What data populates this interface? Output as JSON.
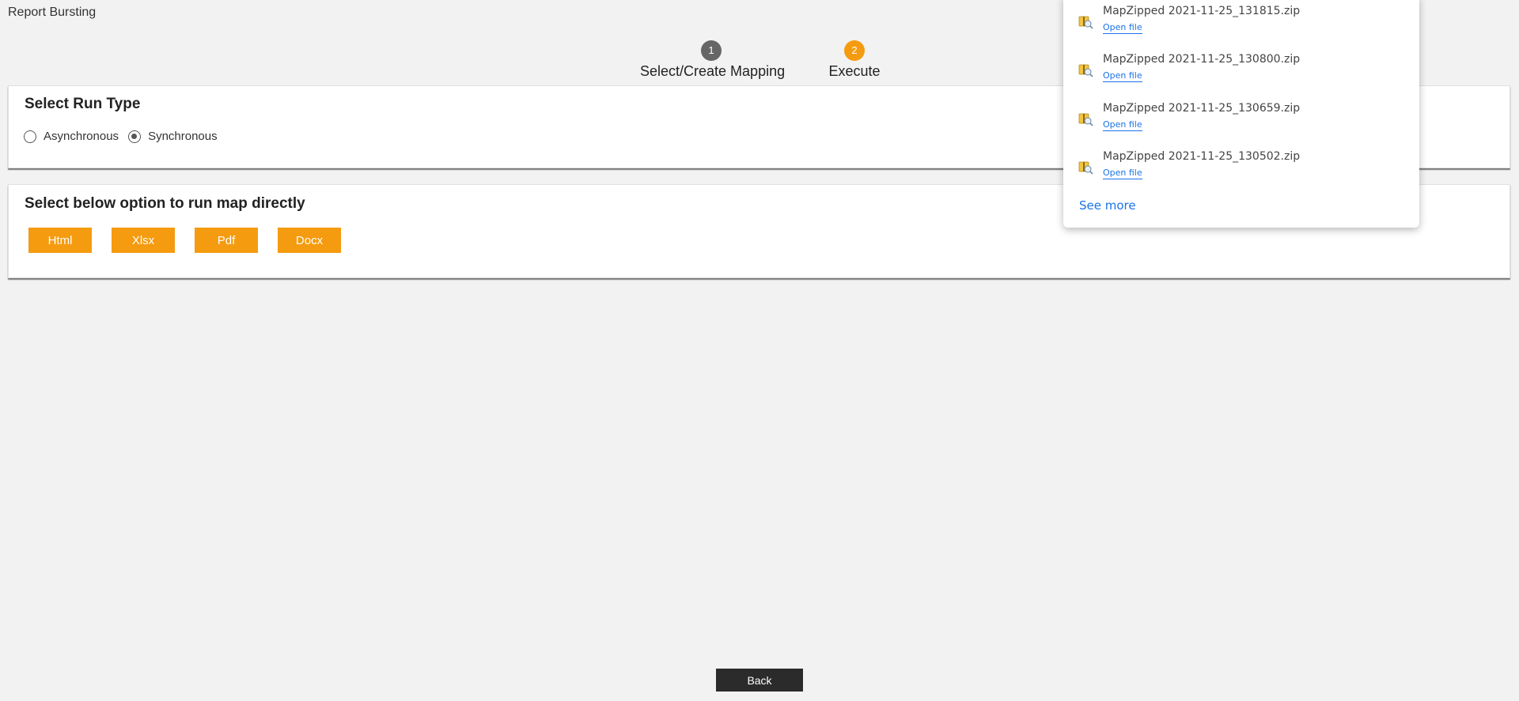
{
  "app": {
    "title": "Report Bursting"
  },
  "stepper": {
    "steps": [
      {
        "number": "1",
        "label": "Select/Create Mapping"
      },
      {
        "number": "2",
        "label": "Execute"
      }
    ]
  },
  "run_type": {
    "title": "Select Run Type",
    "options": [
      {
        "label": "Asynchronous",
        "selected": false
      },
      {
        "label": "Synchronous",
        "selected": true
      }
    ]
  },
  "run_map": {
    "title": "Select below option to run map directly",
    "buttons": [
      "Html",
      "Xlsx",
      "Pdf",
      "Docx"
    ]
  },
  "downloads": {
    "items": [
      {
        "name": "MapZipped 2021-11-25_131815.zip",
        "link": "Open file",
        "icon": "zip-file-icon"
      },
      {
        "name": "MapZipped 2021-11-25_130800.zip",
        "link": "Open file",
        "icon": "zip-file-icon"
      },
      {
        "name": "MapZipped 2021-11-25_130659.zip",
        "link": "Open file",
        "icon": "zip-file-icon"
      },
      {
        "name": "MapZipped 2021-11-25_130502.zip",
        "link": "Open file",
        "icon": "zip-file-icon"
      }
    ],
    "see_more": "See more"
  },
  "footer": {
    "back_label": "Back"
  },
  "colors": {
    "accent": "#f59b0f",
    "step_inactive": "#666666",
    "link": "#1a73e8",
    "back_button": "#2b2b2b"
  }
}
